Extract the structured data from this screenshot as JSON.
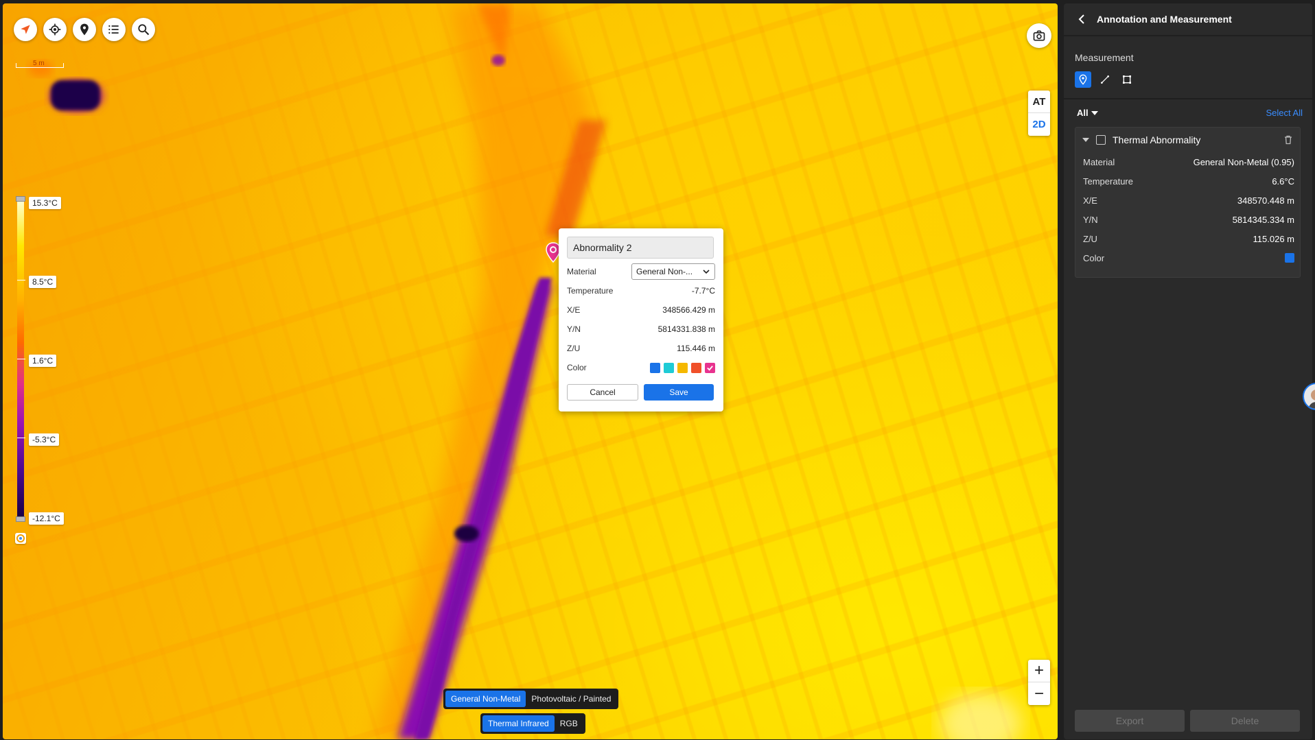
{
  "map": {
    "scale_label": "5 m",
    "toolbar": [
      "compass-icon",
      "locate-icon",
      "pin-icon",
      "list-icon",
      "search-icon"
    ],
    "view_toggle": {
      "at": "AT",
      "two_d": "2D",
      "active": "2D"
    },
    "zoom": {
      "in": "+",
      "out": "−"
    }
  },
  "legend": {
    "labels": [
      "15.3°C",
      "8.5°C",
      "1.6°C",
      "-5.3°C",
      "-12.1°C"
    ]
  },
  "material_toggle": {
    "options": [
      "General Non-Metal",
      "Photovoltaic / Painted"
    ],
    "active": "General Non-Metal"
  },
  "mode_toggle": {
    "options": [
      "Thermal Infrared",
      "RGB"
    ],
    "active": "Thermal Infrared"
  },
  "popup": {
    "name_value": "Abnormality 2",
    "material_label": "Material",
    "material_value": "General Non-...",
    "temperature_label": "Temperature",
    "temperature_value": "-7.7°C",
    "xe_label": "X/E",
    "xe_value": "348566.429 m",
    "yn_label": "Y/N",
    "yn_value": "5814331.838 m",
    "zu_label": "Z/U",
    "zu_value": "115.446 m",
    "color_label": "Color",
    "swatches": [
      "#1a73e8",
      "#1ecbd6",
      "#f5b800",
      "#f0502a",
      "#e8338f"
    ],
    "selected_swatch": "#e8338f",
    "cancel": "Cancel",
    "save": "Save"
  },
  "panel": {
    "title": "Annotation and Measurement",
    "section": "Measurement",
    "filter": "All",
    "select_all": "Select All",
    "item": {
      "title": "Thermal Abnormality",
      "rows": [
        {
          "label": "Material",
          "value": "General Non-Metal (0.95)"
        },
        {
          "label": "Temperature",
          "value": "6.6°C"
        },
        {
          "label": "X/E",
          "value": "348570.448 m"
        },
        {
          "label": "Y/N",
          "value": "5814345.334 m"
        },
        {
          "label": "Z/U",
          "value": "115.026 m"
        },
        {
          "label": "Color",
          "value": ""
        }
      ],
      "color": "#1a73e8"
    },
    "export": "Export",
    "delete": "Delete"
  }
}
